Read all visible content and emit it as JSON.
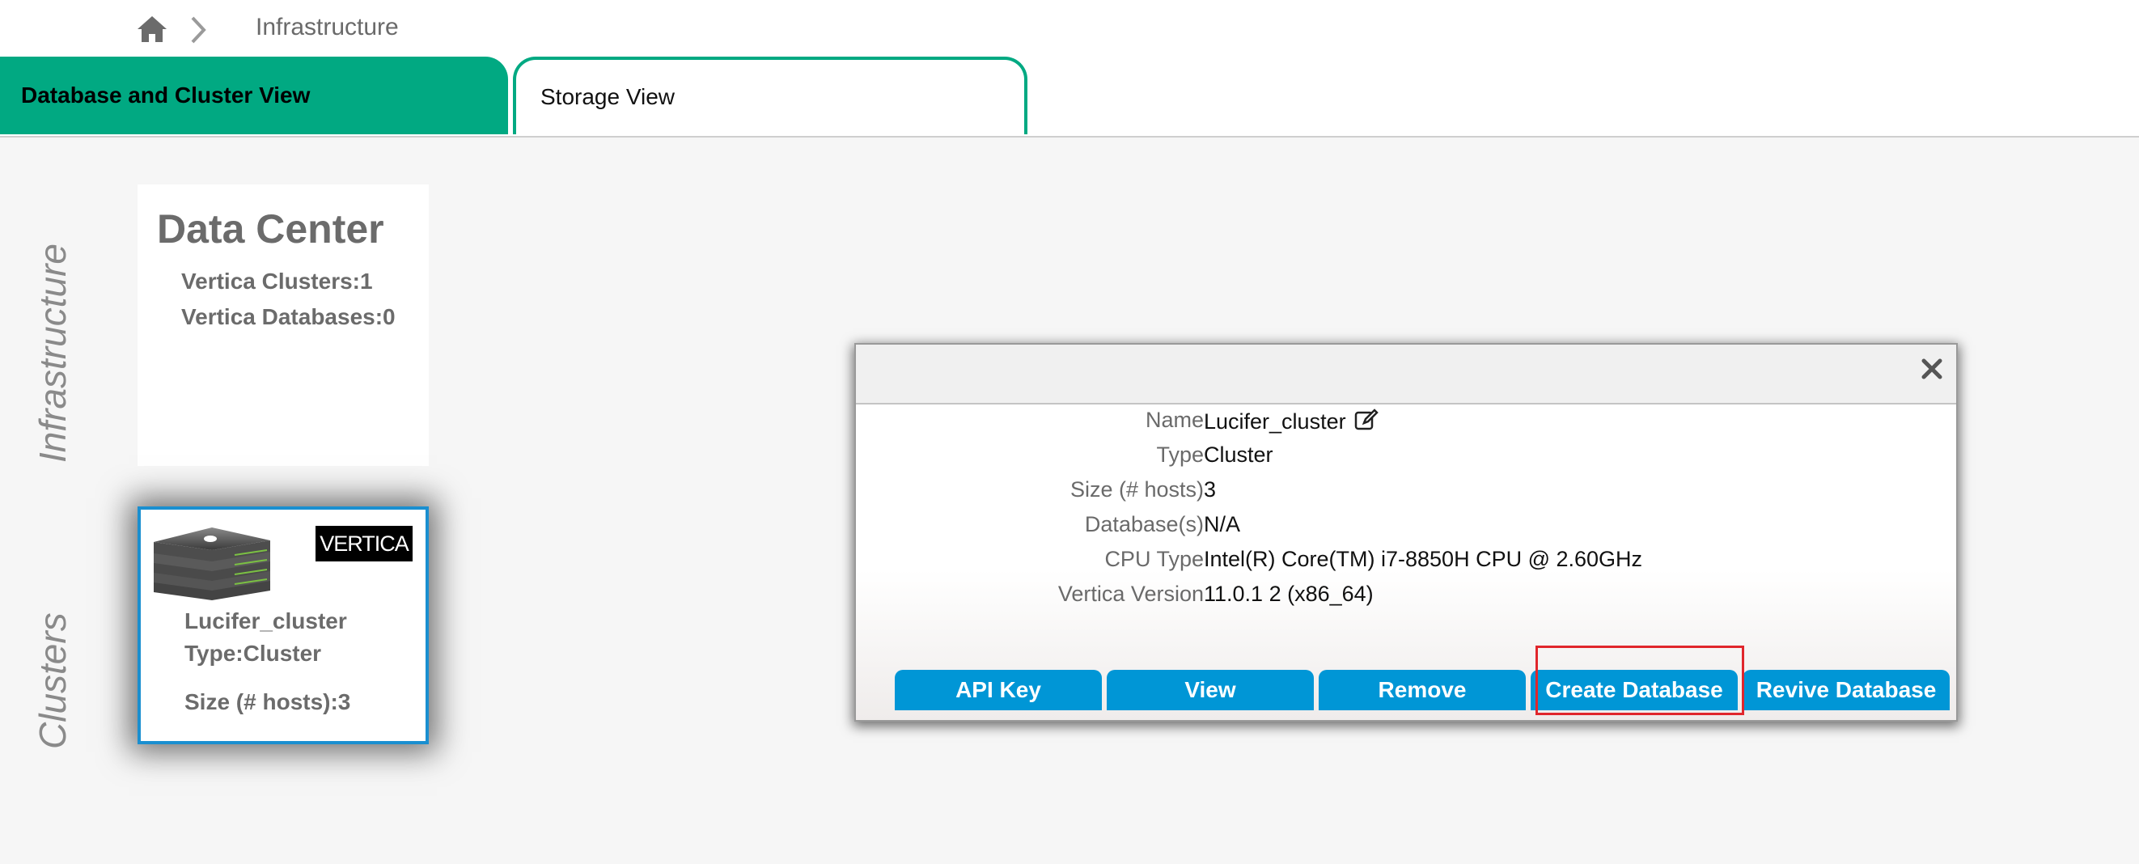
{
  "breadcrumb": {
    "current": "Infrastructure"
  },
  "tabs": [
    {
      "label": "Database and Cluster View",
      "active": true
    },
    {
      "label": "Storage View",
      "active": false
    }
  ],
  "side_labels": {
    "infrastructure": "Infrastructure",
    "clusters": "Clusters"
  },
  "data_center": {
    "title": "Data Center",
    "clusters": "Vertica Clusters:1",
    "databases": "Vertica Databases:0"
  },
  "cluster_card": {
    "logo_text": "VERTICA",
    "name": "Lucifer_cluster",
    "type": "Type:Cluster",
    "size": "Size (# hosts):3"
  },
  "popup": {
    "rows": [
      {
        "label": "Name",
        "value": "Lucifer_cluster"
      },
      {
        "label": "Type",
        "value": "Cluster"
      },
      {
        "label": "Size (# hosts)",
        "value": "3"
      },
      {
        "label": "Database(s)",
        "value": "N/A"
      },
      {
        "label": "CPU Type",
        "value": "Intel(R) Core(TM) i7-8850H CPU @ 2.60GHz"
      },
      {
        "label": "Vertica Version",
        "value": "11.0.1 2 (x86_64)"
      }
    ],
    "buttons": {
      "api_key": "API Key",
      "view": "View",
      "remove": "Remove",
      "create_database": "Create Database",
      "revive_database": "Revive Database"
    }
  },
  "colors": {
    "tab_active": "#01a982",
    "button": "#0096d6",
    "card_border": "#1a8fd0",
    "highlight": "#e0262c"
  }
}
